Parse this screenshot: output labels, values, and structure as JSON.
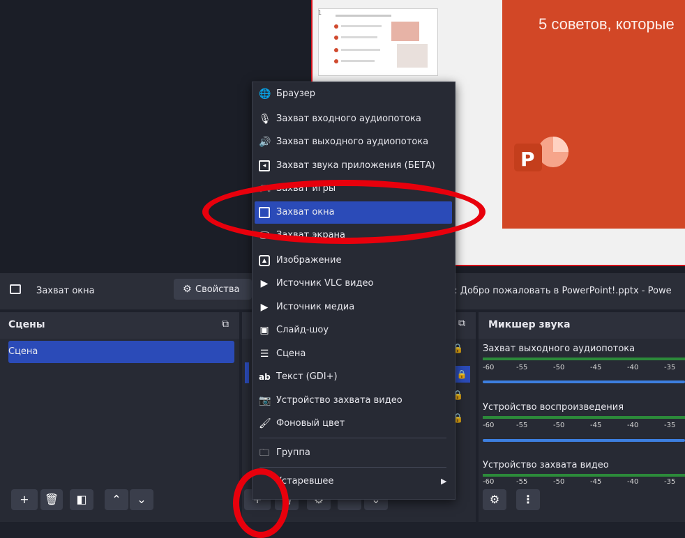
{
  "preview": {
    "slide_text": "5 советов, которые",
    "thumb_number": "1",
    "slide_logo_letter": "P"
  },
  "source_bar": {
    "source_name": "Захват окна",
    "properties_label": "Свойства",
    "window_title": "E]: Добро пожаловать в PowerPoint!.pptx - Powe"
  },
  "scenes": {
    "title": "Сцены",
    "items": [
      "Сцена"
    ]
  },
  "mixer": {
    "title": "Микшер звука",
    "channels": [
      {
        "name": "Захват выходного аудиопотока",
        "ticks": [
          "-60",
          "-55",
          "-50",
          "-45",
          "-40",
          "-35"
        ]
      },
      {
        "name": "Устройство воспроизведения",
        "ticks": [
          "-60",
          "-55",
          "-50",
          "-45",
          "-40",
          "-35"
        ]
      },
      {
        "name": "Устройство захвата видео",
        "ticks": [
          "-60",
          "-55",
          "-50",
          "-45",
          "-40",
          "-35"
        ]
      }
    ]
  },
  "menu": {
    "items": [
      {
        "label": "Браузер",
        "icon": "globe-icon"
      },
      {
        "label": "Захват входного аудиопотока",
        "icon": "microphone-icon"
      },
      {
        "label": "Захват выходного аудиопотока",
        "icon": "speaker-icon"
      },
      {
        "label": "Захват звука приложения (БЕТА)",
        "icon": "app-audio-icon"
      },
      {
        "label": "Захват игры",
        "icon": "gamepad-icon"
      },
      {
        "label": "Захват окна",
        "icon": "window-icon"
      },
      {
        "label": "Захват экрана",
        "icon": "monitor-icon"
      },
      {
        "label": "Изображение",
        "icon": "image-icon"
      },
      {
        "label": "Источник VLC видео",
        "icon": "play-icon"
      },
      {
        "label": "Источник медиа",
        "icon": "play-icon"
      },
      {
        "label": "Слайд-шоу",
        "icon": "slideshow-icon"
      },
      {
        "label": "Сцена",
        "icon": "list-icon"
      },
      {
        "label": "Текст (GDI+)",
        "icon": "text-icon"
      },
      {
        "label": "Устройство захвата видео",
        "icon": "camera-icon"
      },
      {
        "label": "Фоновый цвет",
        "icon": "brush-icon"
      },
      {
        "label": "Группа",
        "icon": "folder-icon"
      },
      {
        "label": "Устаревшее",
        "icon": "submenu-arrow-icon"
      }
    ]
  },
  "colors": {
    "accent_selection": "#2b4bb8",
    "annotation_red": "#e8000c",
    "powerpoint_orange": "#d24726"
  }
}
